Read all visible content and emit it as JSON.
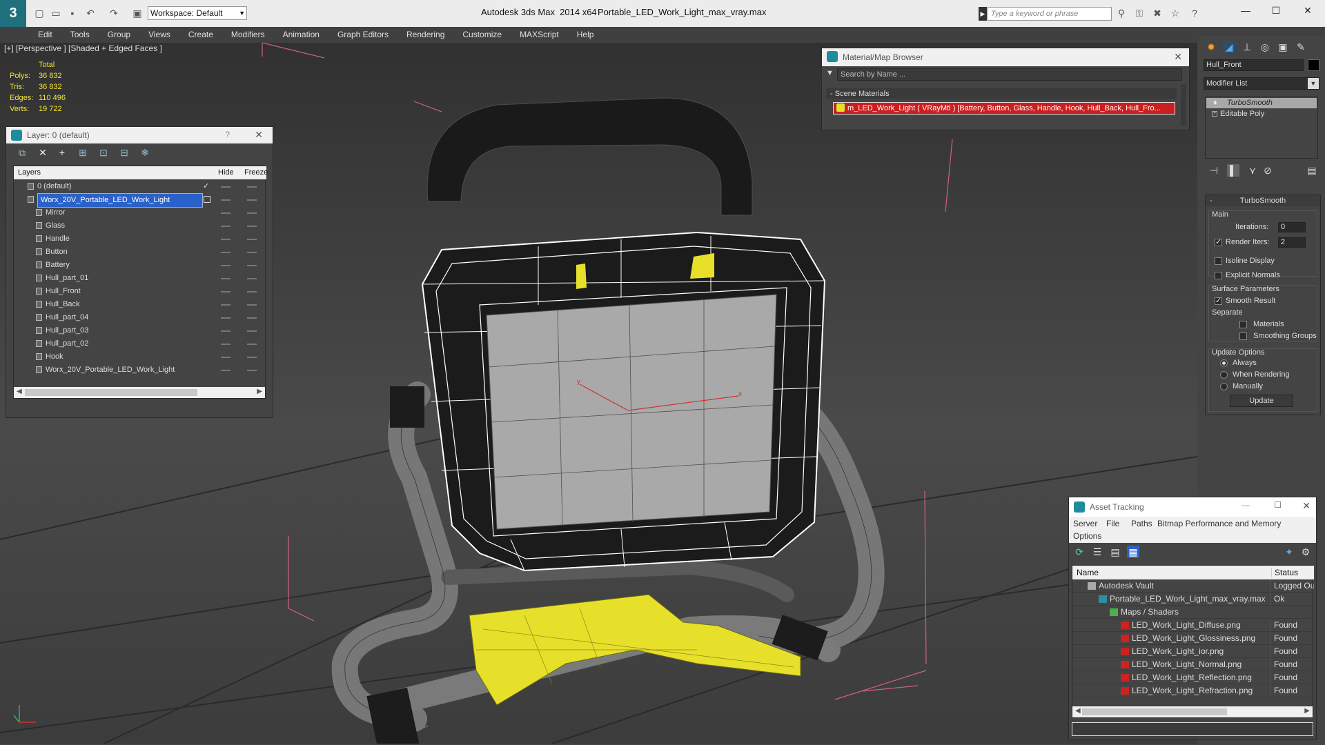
{
  "titlebar": {
    "workspace": "Workspace: Default",
    "app_title": "Autodesk 3ds Max  2014 x64",
    "file_title": "Portable_LED_Work_Light_max_vray.max",
    "search_placeholder": "Type a keyword or phrase"
  },
  "menu": [
    "Edit",
    "Tools",
    "Group",
    "Views",
    "Create",
    "Modifiers",
    "Animation",
    "Graph Editors",
    "Rendering",
    "Customize",
    "MAXScript",
    "Help"
  ],
  "viewport": {
    "label": "[+] [Perspective ] [Shaded + Edged Faces ]",
    "stats": {
      "header": "Total",
      "rows": [
        {
          "label": "Polys:",
          "value": "36 832"
        },
        {
          "label": "Tris:",
          "value": "36 832"
        },
        {
          "label": "Edges:",
          "value": "110 496"
        },
        {
          "label": "Verts:",
          "value": "19 722"
        }
      ]
    },
    "axis_x": "x",
    "axis_y": "y"
  },
  "layer_window": {
    "title": "Layer: 0 (default)",
    "help": "?",
    "columns": {
      "layers": "Layers",
      "hide": "Hide",
      "freeze": "Freeze"
    },
    "rows": [
      {
        "name": "0 (default)",
        "indent": 1
      },
      {
        "name": "Worx_20V_Portable_LED_Work_Light",
        "indent": 1
      },
      {
        "name": "Mirror",
        "indent": 2
      },
      {
        "name": "Glass",
        "indent": 2
      },
      {
        "name": "Handle",
        "indent": 2
      },
      {
        "name": "Button",
        "indent": 2
      },
      {
        "name": "Battery",
        "indent": 2
      },
      {
        "name": "Hull_part_01",
        "indent": 2
      },
      {
        "name": "Hull_Front",
        "indent": 2
      },
      {
        "name": "Hull_Back",
        "indent": 2
      },
      {
        "name": "Hull_part_04",
        "indent": 2
      },
      {
        "name": "Hull_part_03",
        "indent": 2
      },
      {
        "name": "Hull_part_02",
        "indent": 2
      },
      {
        "name": "Hook",
        "indent": 2
      },
      {
        "name": "Worx_20V_Portable_LED_Work_Light",
        "indent": 2
      }
    ]
  },
  "material_browser": {
    "title": "Material/Map Browser",
    "search_placeholder": "Search by Name ...",
    "section": "Scene Materials",
    "material": "m_LED_Work_Light  ( VRayMtl ) [Battery, Button, Glass, Handle, Hook, Hull_Back, Hull_Fro..."
  },
  "command_panel": {
    "object_name": "Hull_Front",
    "modifier_list": "Modifier List",
    "stack": [
      "TurboSmooth",
      "Editable Poly"
    ],
    "rollout_title": "TurboSmooth",
    "main_label": "Main",
    "iterations_label": "Iterations:",
    "iterations_value": "0",
    "render_iters_label": "Render Iters:",
    "render_iters_value": "2",
    "isoline": "Isoline Display",
    "explicit_normals": "Explicit Normals",
    "surface_params": "Surface Parameters",
    "smooth_result": "Smooth Result",
    "separate": "Separate",
    "materials": "Materials",
    "smoothing_groups": "Smoothing Groups",
    "update_options": "Update Options",
    "always": "Always",
    "when_rendering": "When Rendering",
    "manually": "Manually",
    "update_button": "Update"
  },
  "asset_tracking": {
    "title": "Asset Tracking",
    "menu": [
      "Server",
      "File",
      "Paths",
      "Bitmap Performance and Memory"
    ],
    "options": "Options",
    "columns": {
      "name": "Name",
      "status": "Status"
    },
    "rows": [
      {
        "name": "Autodesk Vault",
        "status": "Logged Ou",
        "indent": 0,
        "icon": "vault"
      },
      {
        "name": "Portable_LED_Work_Light_max_vray.max",
        "status": "Ok",
        "indent": 1,
        "icon": "max"
      },
      {
        "name": "Maps / Shaders",
        "status": "",
        "indent": 2,
        "icon": "maps"
      },
      {
        "name": "LED_Work_Light_Diffuse.png",
        "status": "Found",
        "indent": 3,
        "icon": "png"
      },
      {
        "name": "LED_Work_Light_Glossiness.png",
        "status": "Found",
        "indent": 3,
        "icon": "png"
      },
      {
        "name": "LED_Work_Light_ior.png",
        "status": "Found",
        "indent": 3,
        "icon": "png"
      },
      {
        "name": "LED_Work_Light_Normal.png",
        "status": "Found",
        "indent": 3,
        "icon": "png"
      },
      {
        "name": "LED_Work_Light_Reflection.png",
        "status": "Found",
        "indent": 3,
        "icon": "png"
      },
      {
        "name": "LED_Work_Light_Refraction.png",
        "status": "Found",
        "indent": 3,
        "icon": "png"
      }
    ]
  },
  "colors": {
    "accent": "#2a62c9",
    "yellow": "#e7e02a",
    "selection": "#cc1e1e"
  }
}
